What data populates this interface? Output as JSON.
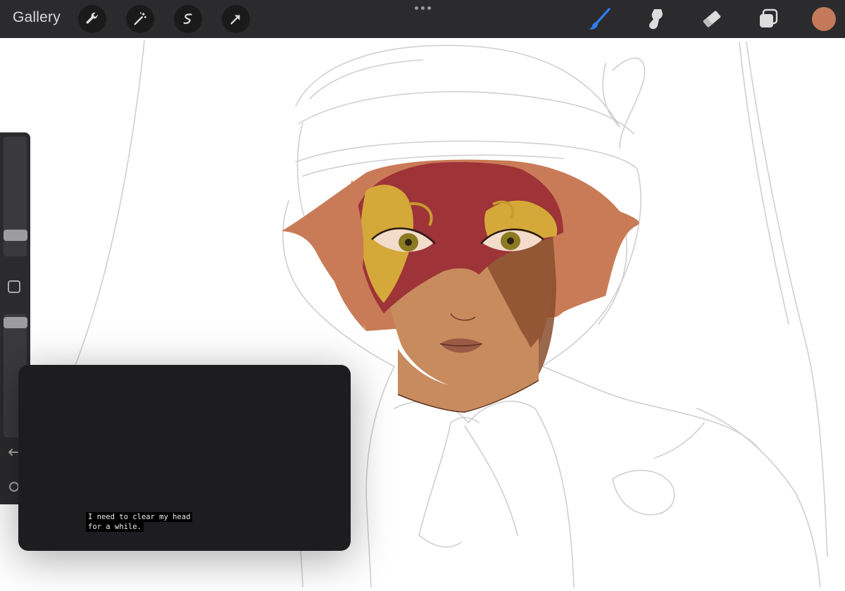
{
  "toolbar": {
    "gallery_label": "Gallery",
    "left_tools": [
      "wrench-icon",
      "magic-wand-icon",
      "selection-icon",
      "transform-arrow-icon"
    ],
    "right_tools": [
      "brush-icon",
      "smudge-icon",
      "eraser-icon",
      "layers-icon"
    ],
    "active_tool": "brush-icon",
    "current_color": "#c47a5a",
    "accent_color": "#2f7ff7"
  },
  "sidebar": {
    "brush_size": 0.2,
    "opacity": 0.9,
    "modify_button": "square-icon",
    "undo": "undo-icon",
    "redo": "redo-icon"
  },
  "caption": {
    "line1": "I need to clear my head",
    "line2": "for a while."
  }
}
